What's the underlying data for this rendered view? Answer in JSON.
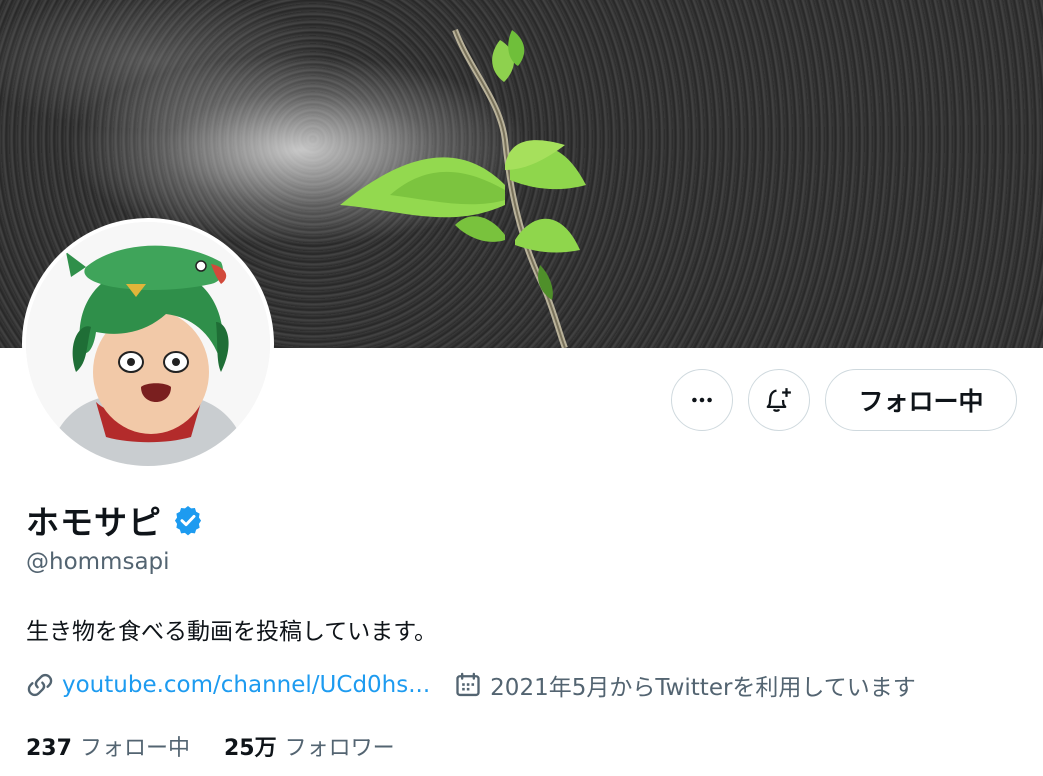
{
  "profile": {
    "display_name": "ホモサピ",
    "handle": "@hommsapi",
    "verified_icon": "verified-badge-icon",
    "bio": "生き物を食べる動画を投稿しています。",
    "link": "youtube.com/channel/UCd0hs...",
    "joined": "2021年5月からTwitterを利用しています"
  },
  "actions": {
    "more_icon": "more-dots-icon",
    "notify_icon": "bell-plus-icon",
    "follow_label": "フォロー中"
  },
  "stats": {
    "following_count": "237",
    "following_label": "フォロー中",
    "followers_count": "25万",
    "followers_label": "フォロワー"
  },
  "colors": {
    "accent": "#1d9bf0",
    "muted_text": "#536471",
    "primary_text": "#0f1419",
    "border": "#cfd9de"
  }
}
